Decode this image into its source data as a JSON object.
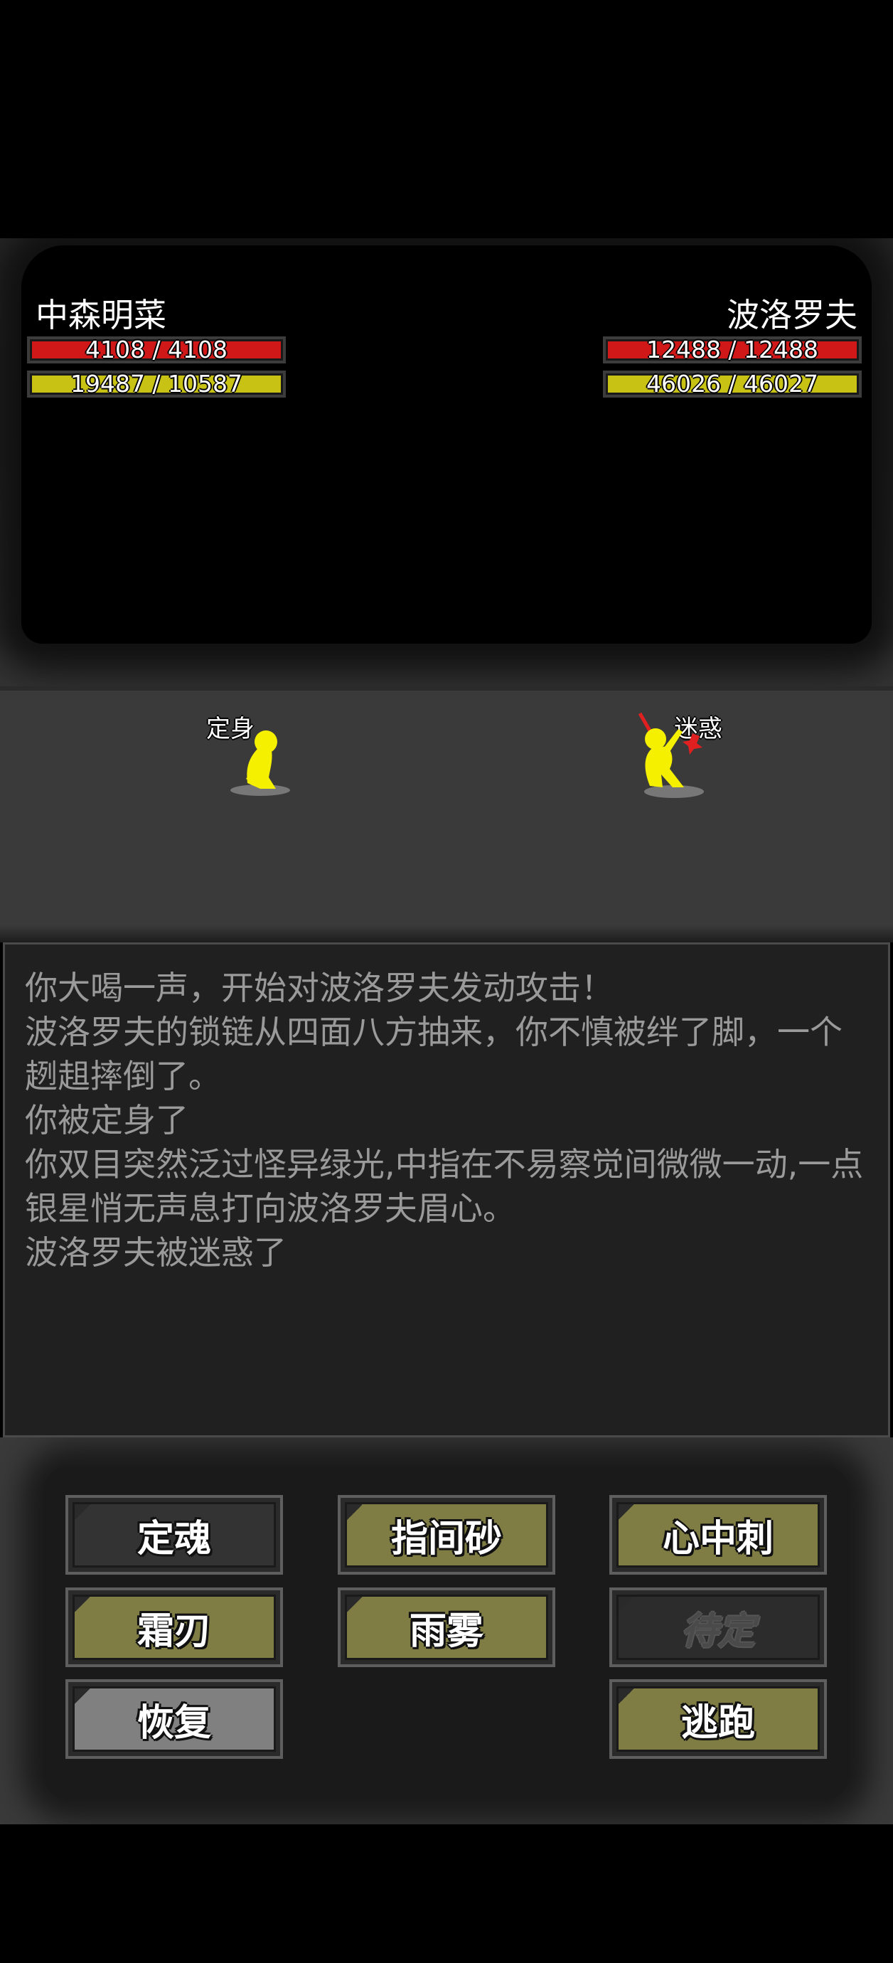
{
  "player": {
    "name": "中森明菜",
    "hp": {
      "text": "4108 / 4108",
      "fraction": 1.0
    },
    "mp": {
      "text": "19487 / 10587",
      "fraction": 1.0
    },
    "status": "定身"
  },
  "enemy": {
    "name": "波洛罗夫",
    "hp": {
      "text": "12488 / 12488",
      "fraction": 1.0
    },
    "mp": {
      "text": "46026 / 46027",
      "fraction": 1.0
    },
    "status": "迷惑"
  },
  "log": [
    "你大喝一声，开始对波洛罗夫发动攻击！",
    "波洛罗夫的锁链从四面八方抽来，你不慎被绊了脚，一个趔趄摔倒了。",
    "你被定身了",
    "你双目突然泛过怪异绿光,中指在不易察觉间微微一动,一点银星悄无声息打向波洛罗夫眉心。",
    "波洛罗夫被迷惑了"
  ],
  "commands": {
    "dinghun": "定魂",
    "zhijiansha": "指间砂",
    "xinzhongci": "心中刺",
    "shuangren": "霜刃",
    "yuwu": "雨雾",
    "daiding": "待定",
    "huifu": "恢复",
    "taopao": "逃跑"
  },
  "colors": {
    "hp": "#d01818",
    "mp": "#c8c214",
    "fighter": "#f5f000",
    "button_olive": "#7f7d44"
  },
  "icons": {
    "player": "yellow-stick-figure-kneeling",
    "enemy": "yellow-stick-figure-with-weapon"
  }
}
